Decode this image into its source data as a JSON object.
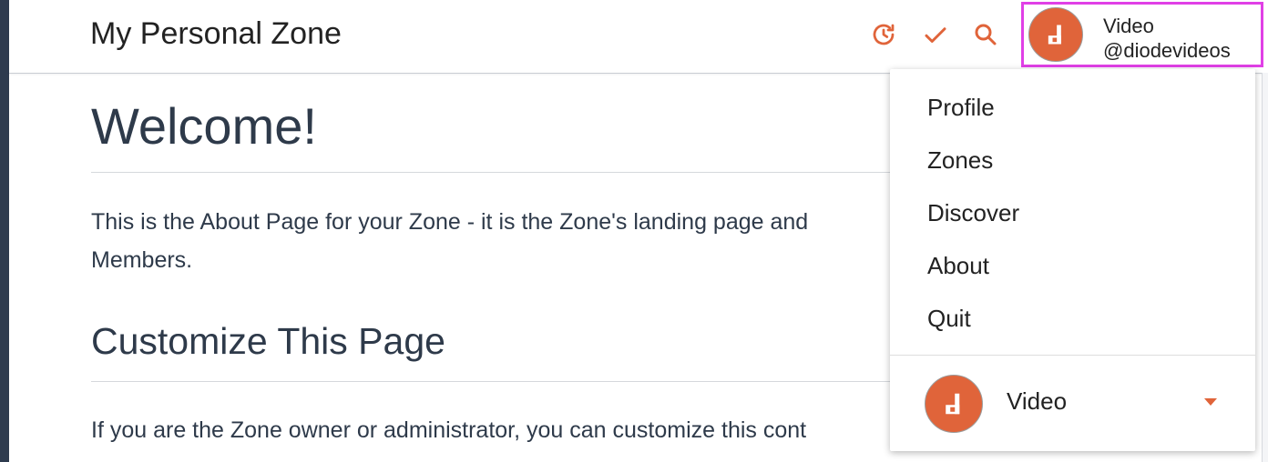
{
  "header": {
    "zone_title": "My Personal Zone",
    "icons": [
      "history-icon",
      "check-icon",
      "search-icon"
    ],
    "accent_color": "#e0643a"
  },
  "user": {
    "name": "Video",
    "handle": "@diodevideos",
    "avatar_color": "#e0643a",
    "highlight_color": "#e040e6"
  },
  "main": {
    "heading": "Welcome!",
    "paragraph1": "This is the About Page for your Zone - it is the Zone's landing page and … Members.",
    "paragraph1_line1": "This is the About Page for your Zone - it is the Zone's landing page and",
    "paragraph1_line2": "Members.",
    "subheading": "Customize This Page",
    "paragraph2": "If you are the Zone owner or administrator, you can customize this cont"
  },
  "dropdown_menu": {
    "items": [
      "Profile",
      "Zones",
      "Discover",
      "About",
      "Quit"
    ],
    "account": {
      "name": "Video"
    }
  }
}
